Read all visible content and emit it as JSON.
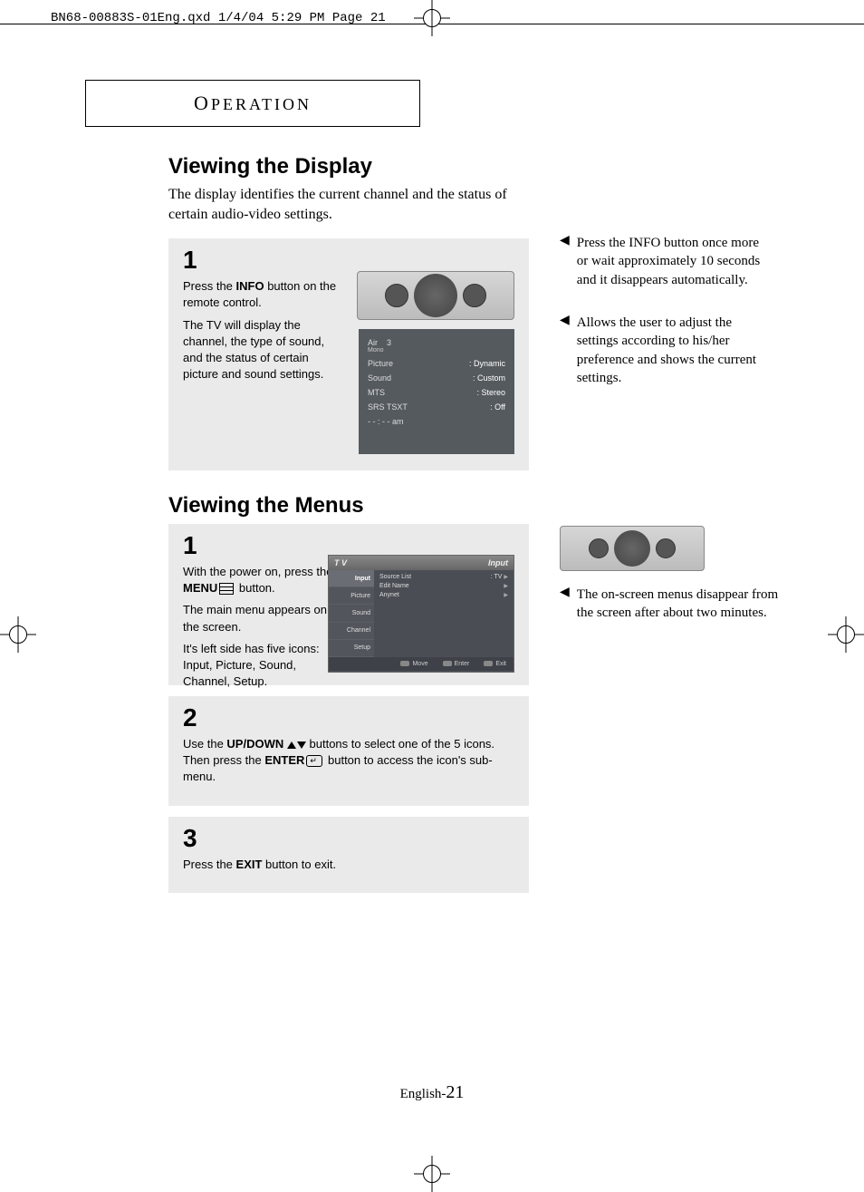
{
  "header": {
    "imprint": "BN68-00883S-01Eng.qxd  1/4/04 5:29 PM  Page 21"
  },
  "section_label": "OPERATION",
  "viewing_display": {
    "title": "Viewing the Display",
    "intro": "The display identifies the current channel and the status of certain audio-video settings.",
    "step1": {
      "num": "1",
      "line1_pre": "Press the ",
      "line1_bold": "INFO",
      "line1_post": " button on the remote control.",
      "line2": "The TV will display the channel, the type of sound, and the status of certain picture and sound settings."
    },
    "osd": {
      "air_label": "Air",
      "air_val": "3",
      "mono": "Mono",
      "rows": [
        {
          "k": "Picture",
          "v": ": Dynamic"
        },
        {
          "k": "Sound",
          "v": ": Custom"
        },
        {
          "k": "MTS",
          "v": ": Stereo"
        },
        {
          "k": "SRS TSXT",
          "v": ": Off"
        }
      ],
      "time": "- - : - -  am"
    },
    "notes": [
      "Press the INFO button once more or wait approximately 10 seconds and it disappears automatically.",
      "Allows the user to adjust the settings according to his/her preference and shows the current settings."
    ]
  },
  "viewing_menus": {
    "title": "Viewing the Menus",
    "step1": {
      "num": "1",
      "line1_pre": "With the power on, press the ",
      "line1_bold": "MENU",
      "line1_post": " button.",
      "line2": "The main menu appears on the screen.",
      "line3": "It's left side has five icons: Input, Picture, Sound, Channel, Setup."
    },
    "menu_screen": {
      "topbar_left": "T V",
      "topbar_right": "Input",
      "side": [
        "Input",
        "Picture",
        "Sound",
        "Channel",
        "Setup"
      ],
      "rows": [
        {
          "k": "Source List",
          "v": ": TV"
        },
        {
          "k": "Edit Name",
          "v": ""
        },
        {
          "k": "Anynet",
          "v": ""
        }
      ],
      "footer": [
        "Move",
        "Enter",
        "Exit"
      ]
    },
    "step2": {
      "num": "2",
      "line_pre": "Use the ",
      "line_bold": "UP/DOWN",
      "line_mid": " buttons to select one of the 5 icons. Then press the ",
      "line_bold2": "ENTER",
      "line_post": " button to access the icon's sub-menu."
    },
    "step3": {
      "num": "3",
      "line_pre": "Press the ",
      "line_bold": "EXIT",
      "line_post": " button to exit."
    },
    "note": "The on-screen menus disappear from the screen after about two minutes."
  },
  "footer": {
    "lang": "English-",
    "page": "21"
  }
}
